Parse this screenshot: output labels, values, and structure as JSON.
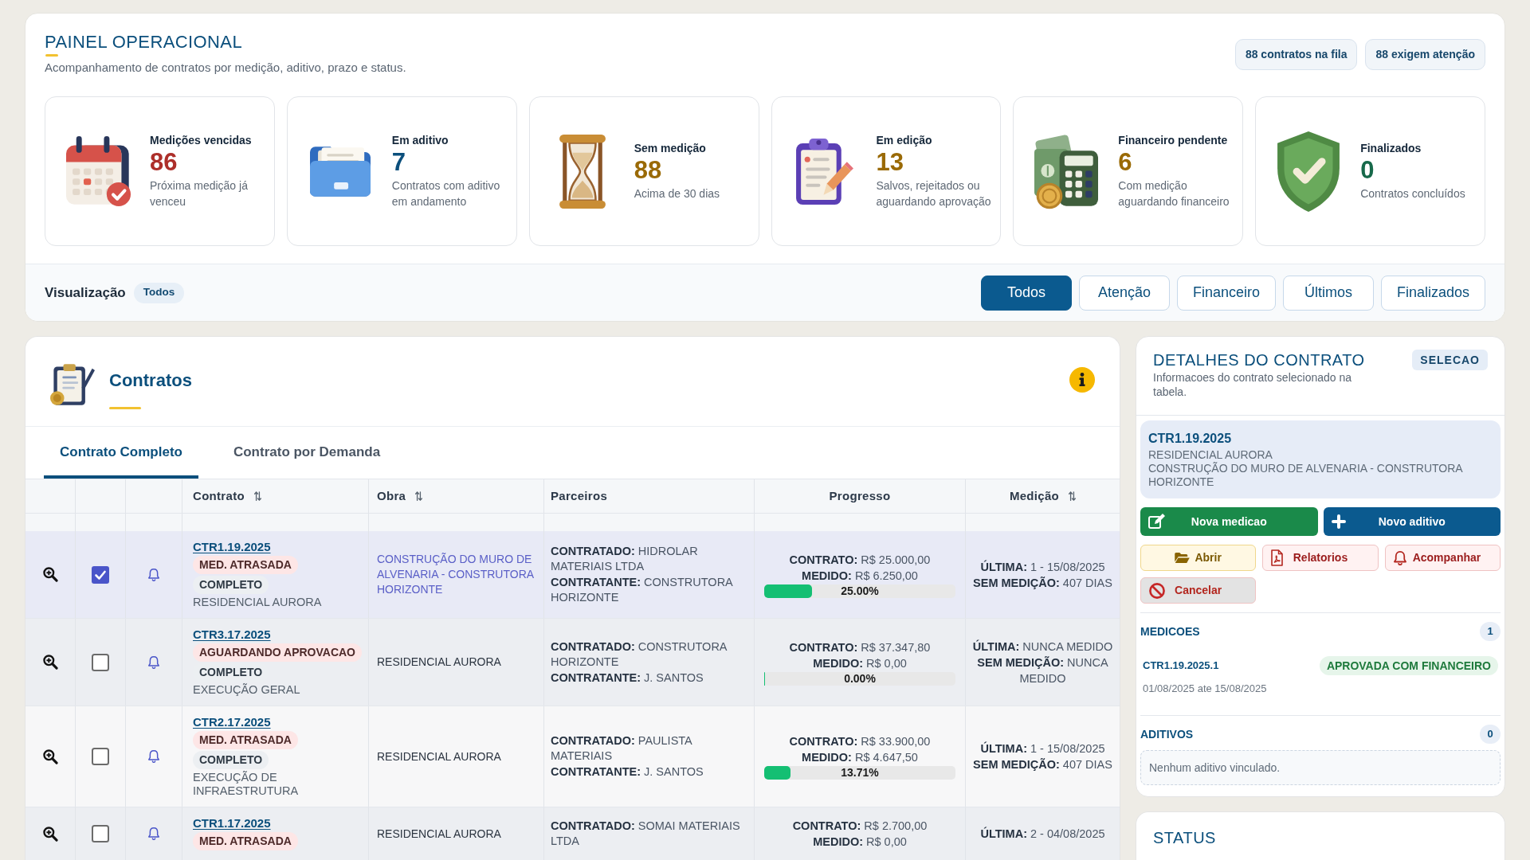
{
  "header": {
    "title": "PAINEL OPERACIONAL",
    "subtitle": "Acompanhamento de contratos por medição, aditivo, prazo e status.",
    "badges": [
      "88 contratos na fila",
      "88 exigem atenção"
    ]
  },
  "stats": [
    {
      "kind": "overdue",
      "title": "Medições vencidas",
      "value": "86",
      "color": "#ad2f2a",
      "description": "Próxima medição já venceu"
    },
    {
      "kind": "amendment",
      "title": "Em aditivo",
      "value": "7",
      "color": "#0b4f7c",
      "description": "Contratos com aditivo em andamento"
    },
    {
      "kind": "unmeasured",
      "title": "Sem medição",
      "value": "88",
      "color": "#9a6a06",
      "description": "Acima de 30 dias"
    },
    {
      "kind": "editing",
      "title": "Em edição",
      "value": "13",
      "color": "#9a6a06",
      "description": "Salvos, rejeitados ou aguardando aprovação"
    },
    {
      "kind": "finance",
      "title": "Financeiro pendente",
      "value": "6",
      "color": "#9a6a06",
      "description": "Com medição aguardando financeiro"
    },
    {
      "kind": "done",
      "title": "Finalizados",
      "value": "0",
      "color": "#17694a",
      "description": "Contratos concluídos"
    }
  ],
  "view_bar": {
    "label": "Visualização",
    "current": "Todos",
    "filters": [
      {
        "label": "Todos",
        "selected": true
      },
      {
        "label": "Atenção",
        "selected": false
      },
      {
        "label": "Financeiro",
        "selected": false
      },
      {
        "label": "Últimos",
        "selected": false
      },
      {
        "label": "Finalizados",
        "selected": false
      }
    ]
  },
  "contracts": {
    "title": "Contratos",
    "tabs": [
      {
        "label": "Contrato Completo",
        "selected": true
      },
      {
        "label": "Contrato por Demanda",
        "selected": false
      }
    ],
    "columns": [
      {
        "label": "Contrato",
        "sortable": true
      },
      {
        "label": "Obra",
        "sortable": true
      },
      {
        "label": "Parceiros",
        "sortable": false
      },
      {
        "label": "Progresso",
        "sortable": false
      },
      {
        "label": "Medição",
        "sortable": true
      }
    ],
    "rows": [
      {
        "selected": true,
        "checked": true,
        "code": "CTR1.19.2025",
        "tags": [
          {
            "kind": "alert",
            "text": "MED. ATRASADA"
          },
          {
            "kind": "type",
            "text": "COMPLETO"
          }
        ],
        "project": "RESIDENCIAL AURORA",
        "obra": "CONSTRUÇÃO DO MURO DE ALVENARIA - CONSTRUTORA HORIZONTE",
        "partners": [
          "**CONTRATADO:** HIDROLAR MATERIAIS LTDA",
          "**CONTRATANTE:** CONSTRUTORA HORIZONTE"
        ],
        "amounts": [
          "**CONTRATO:** R$ 25.000,00",
          "**MEDIDO:** R$ 6.250,00"
        ],
        "progress": {
          "level": 0.25,
          "reading": "25.00%"
        },
        "measurement": [
          "**ÚLTIMA:** 1 - 15/08/2025",
          "**SEM MEDIÇÃO:** 407 DIAS"
        ]
      },
      {
        "selected": false,
        "checked": false,
        "code": "CTR3.17.2025",
        "tags": [
          {
            "kind": "alert",
            "text": "AGUARDANDO APROVACAO"
          },
          {
            "kind": "type",
            "text": "COMPLETO"
          }
        ],
        "project": "EXECUÇÃO GERAL",
        "obra": "RESIDENCIAL AURORA",
        "partners": [
          "**CONTRATADO:** CONSTRUTORA HORIZONTE",
          "**CONTRATANTE:** J. SANTOS"
        ],
        "amounts": [
          "**CONTRATO:** R$ 37.347,80",
          "**MEDIDO:** R$ 0,00"
        ],
        "progress": {
          "level": 0,
          "reading": "0.00%"
        },
        "measurement": [
          "**ÚLTIMA:** NUNCA MEDIDO",
          "**SEM MEDIÇÃO:** NUNCA MEDIDO"
        ]
      },
      {
        "selected": false,
        "checked": false,
        "code": "CTR2.17.2025",
        "tags": [
          {
            "kind": "alert",
            "text": "MED. ATRASADA"
          },
          {
            "kind": "type",
            "text": "COMPLETO"
          }
        ],
        "project": "EXECUÇÃO DE INFRAESTRUTURA",
        "obra": "RESIDENCIAL AURORA",
        "partners": [
          "**CONTRATADO:** PAULISTA MATERIAIS",
          "**CONTRATANTE:** J. SANTOS"
        ],
        "amounts": [
          "**CONTRATO:** R$ 33.900,00",
          "**MEDIDO:** R$ 4.647,50"
        ],
        "progress": {
          "level": 0.1371,
          "reading": "13.71%"
        },
        "measurement": [
          "**ÚLTIMA:** 1 - 15/08/2025",
          "**SEM MEDIÇÃO:** 407 DIAS"
        ]
      },
      {
        "selected": false,
        "checked": false,
        "code": "CTR1.17.2025",
        "tags": [
          {
            "kind": "alert",
            "text": "MED. ATRASADA"
          }
        ],
        "obra": "RESIDENCIAL AURORA",
        "partners": [
          "**CONTRATADO:** SOMAI MATERIAIS LTDA"
        ],
        "amounts": [
          "**CONTRATO:** R$ 2.700,00",
          "**MEDIDO:** R$ 0,00"
        ],
        "measurement": [
          "**ÚLTIMA:** 2 - 04/08/2025"
        ]
      }
    ]
  },
  "details": {
    "title": "DETALHES DO CONTRATO",
    "badge": "SELECAO",
    "subtitle": "Informacoes do contrato selecionado na tabela.",
    "contract": {
      "code": "CTR1.19.2025",
      "project": "RESIDENCIAL AURORA",
      "description": "CONSTRUÇÃO DO MURO DE ALVENARIA - CONSTRUTORA HORIZONTE"
    },
    "actions": [
      {
        "kind": "measure",
        "label": "Nova medicao"
      },
      {
        "kind": "amend",
        "label": "Novo aditivo"
      },
      {
        "kind": "open",
        "label": "Abrir"
      },
      {
        "kind": "report",
        "label": "Relatorios"
      },
      {
        "kind": "follow",
        "label": "Acompanhar"
      },
      {
        "kind": "cancel",
        "label": "Cancelar"
      }
    ],
    "measurements": {
      "title": "MEDICOES",
      "count": "1",
      "items": [
        {
          "code": "CTR1.19.2025.1",
          "status": "APROVADA COM FINANCEIRO",
          "period": "01/08/2025 ate 15/08/2025"
        }
      ]
    },
    "amendments": {
      "title": "ADITIVOS",
      "count": "0",
      "empty": "Nenhum aditivo vinculado."
    }
  },
  "status_card": {
    "title": "STATUS"
  }
}
